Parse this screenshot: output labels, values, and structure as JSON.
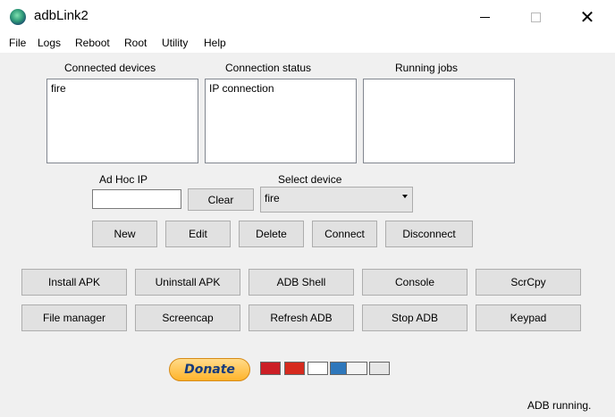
{
  "window": {
    "title": "adbLink2",
    "close_glyph": "✕"
  },
  "menu": [
    "File",
    "Logs",
    "Reboot",
    "Root",
    "Utility",
    "Help"
  ],
  "lists": {
    "devices": {
      "label": "Connected devices",
      "items": [
        "fire"
      ]
    },
    "status": {
      "label": "Connection status",
      "items": [
        "IP connection"
      ]
    },
    "jobs": {
      "label": "Running jobs",
      "items": []
    }
  },
  "adhoc": {
    "label": "Ad Hoc IP",
    "value": "",
    "clear_label": "Clear"
  },
  "select_device": {
    "label": "Select device",
    "value": "fire"
  },
  "device_buttons": {
    "new": "New",
    "edit": "Edit",
    "delete": "Delete",
    "connect": "Connect",
    "disconnect": "Disconnect"
  },
  "tools": {
    "install_apk": "Install APK",
    "uninstall_apk": "Uninstall APK",
    "adb_shell": "ADB Shell",
    "console": "Console",
    "scrcpy": "ScrCpy",
    "file_manager": "File manager",
    "screencap": "Screencap",
    "refresh_adb": "Refresh ADB",
    "stop_adb": "Stop ADB",
    "keypad": "Keypad"
  },
  "donate": {
    "label": "Donate",
    "cards": {
      "maestro": "Maestro",
      "mastercard": "MasterCard",
      "visa": "VISA",
      "amex": "AMEX",
      "discover": "DISCOVER",
      "bank": "BANK"
    }
  },
  "status_bar": {
    "text": "ADB running."
  }
}
